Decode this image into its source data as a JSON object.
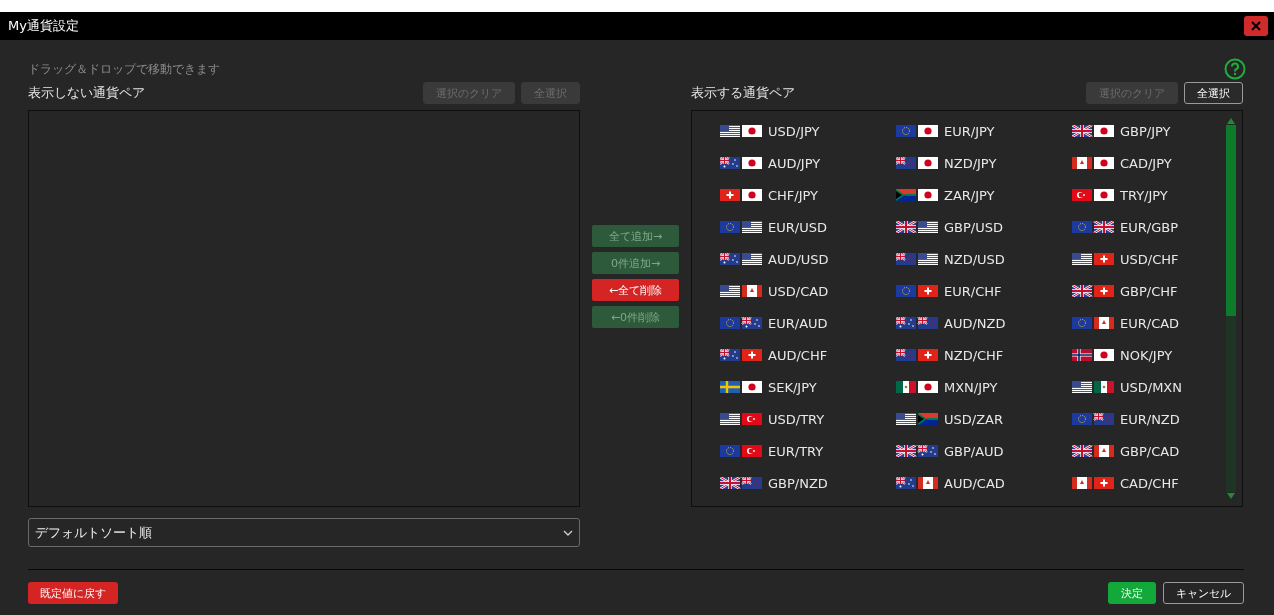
{
  "window": {
    "title": "My通貨設定"
  },
  "hint": "ドラッグ＆ドロップで移動できます",
  "hidden_panel": {
    "title": "表示しない通貨ペア",
    "buttons": [
      {
        "label": "選択のクリア",
        "disabled": true
      },
      {
        "label": "全選択",
        "disabled": true
      }
    ],
    "sort": {
      "value": "デフォルトソート順"
    }
  },
  "move_buttons": [
    {
      "label": "全て追加→",
      "kind": "add",
      "disabled": true
    },
    {
      "label": "0件追加→",
      "kind": "add",
      "disabled": true
    },
    {
      "label": "←全て削除",
      "kind": "remove",
      "disabled": false
    },
    {
      "label": "←0件削除",
      "kind": "add",
      "disabled": true
    }
  ],
  "shown_panel": {
    "title": "表示する通貨ペア",
    "buttons": [
      {
        "label": "選択のクリア",
        "disabled": true
      },
      {
        "label": "全選択",
        "disabled": false
      }
    ],
    "pairs": [
      {
        "label": "USD/JPY"
      },
      {
        "label": "EUR/JPY"
      },
      {
        "label": "GBP/JPY"
      },
      {
        "label": "AUD/JPY"
      },
      {
        "label": "NZD/JPY"
      },
      {
        "label": "CAD/JPY"
      },
      {
        "label": "CHF/JPY"
      },
      {
        "label": "ZAR/JPY"
      },
      {
        "label": "TRY/JPY"
      },
      {
        "label": "EUR/USD"
      },
      {
        "label": "GBP/USD"
      },
      {
        "label": "EUR/GBP"
      },
      {
        "label": "AUD/USD"
      },
      {
        "label": "NZD/USD"
      },
      {
        "label": "USD/CHF"
      },
      {
        "label": "USD/CAD"
      },
      {
        "label": "EUR/CHF"
      },
      {
        "label": "GBP/CHF"
      },
      {
        "label": "EUR/AUD"
      },
      {
        "label": "AUD/NZD"
      },
      {
        "label": "EUR/CAD"
      },
      {
        "label": "AUD/CHF"
      },
      {
        "label": "NZD/CHF"
      },
      {
        "label": "NOK/JPY"
      },
      {
        "label": "SEK/JPY"
      },
      {
        "label": "MXN/JPY"
      },
      {
        "label": "USD/MXN"
      },
      {
        "label": "USD/TRY"
      },
      {
        "label": "USD/ZAR"
      },
      {
        "label": "EUR/NZD"
      },
      {
        "label": "EUR/TRY"
      },
      {
        "label": "GBP/AUD"
      },
      {
        "label": "GBP/CAD"
      },
      {
        "label": "GBP/NZD"
      },
      {
        "label": "AUD/CAD"
      },
      {
        "label": "CAD/CHF"
      }
    ]
  },
  "footer": {
    "reset": "既定値に戻す",
    "ok": "決定",
    "cancel": "キャンセル"
  }
}
